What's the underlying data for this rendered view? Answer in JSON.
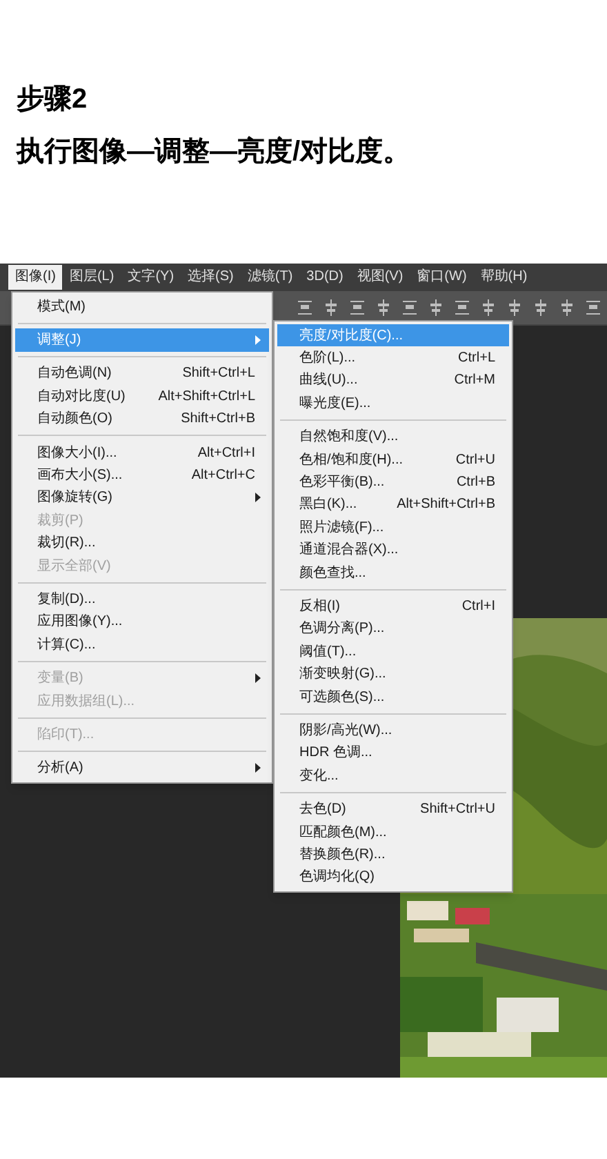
{
  "heading": "步骤2",
  "instruction": "执行图像—调整—亮度/对比度。",
  "menubar": [
    {
      "label": "图像(I)",
      "selected": true
    },
    {
      "label": "图层(L)",
      "selected": false
    },
    {
      "label": "文字(Y)",
      "selected": false
    },
    {
      "label": "选择(S)",
      "selected": false
    },
    {
      "label": "滤镜(T)",
      "selected": false
    },
    {
      "label": "3D(D)",
      "selected": false
    },
    {
      "label": "视图(V)",
      "selected": false
    },
    {
      "label": "窗口(W)",
      "selected": false
    },
    {
      "label": "帮助(H)",
      "selected": false
    }
  ],
  "menu": [
    [
      {
        "label": "模式(M)",
        "disabled": false,
        "submenu": false,
        "selected": false
      }
    ],
    [
      {
        "label": "调整(J)",
        "disabled": false,
        "submenu": true,
        "selected": true
      }
    ],
    [
      {
        "label": "自动色调(N)",
        "shortcut": "Shift+Ctrl+L",
        "disabled": false,
        "submenu": false,
        "selected": false
      },
      {
        "label": "自动对比度(U)",
        "shortcut": "Alt+Shift+Ctrl+L",
        "disabled": false,
        "submenu": false,
        "selected": false
      },
      {
        "label": "自动颜色(O)",
        "shortcut": "Shift+Ctrl+B",
        "disabled": false,
        "submenu": false,
        "selected": false
      }
    ],
    [
      {
        "label": "图像大小(I)...",
        "shortcut": "Alt+Ctrl+I",
        "disabled": false,
        "submenu": false,
        "selected": false
      },
      {
        "label": "画布大小(S)...",
        "shortcut": "Alt+Ctrl+C",
        "disabled": false,
        "submenu": false,
        "selected": false
      },
      {
        "label": "图像旋转(G)",
        "disabled": false,
        "submenu": true,
        "selected": false
      },
      {
        "label": "裁剪(P)",
        "disabled": true,
        "submenu": false,
        "selected": false
      },
      {
        "label": "裁切(R)...",
        "disabled": false,
        "submenu": false,
        "selected": false
      },
      {
        "label": "显示全部(V)",
        "disabled": true,
        "submenu": false,
        "selected": false
      }
    ],
    [
      {
        "label": "复制(D)...",
        "disabled": false,
        "submenu": false,
        "selected": false
      },
      {
        "label": "应用图像(Y)...",
        "disabled": false,
        "submenu": false,
        "selected": false
      },
      {
        "label": "计算(C)...",
        "disabled": false,
        "submenu": false,
        "selected": false
      }
    ],
    [
      {
        "label": "变量(B)",
        "disabled": true,
        "submenu": true,
        "selected": false
      },
      {
        "label": "应用数据组(L)...",
        "disabled": true,
        "submenu": false,
        "selected": false
      }
    ],
    [
      {
        "label": "陷印(T)...",
        "disabled": true,
        "submenu": false,
        "selected": false
      }
    ],
    [
      {
        "label": "分析(A)",
        "disabled": false,
        "submenu": true,
        "selected": false
      }
    ]
  ],
  "submenu": [
    [
      {
        "label": "亮度/对比度(C)...",
        "selected": true
      },
      {
        "label": "色阶(L)...",
        "shortcut": "Ctrl+L",
        "selected": false
      },
      {
        "label": "曲线(U)...",
        "shortcut": "Ctrl+M",
        "selected": false
      },
      {
        "label": "曝光度(E)...",
        "selected": false
      }
    ],
    [
      {
        "label": "自然饱和度(V)...",
        "selected": false
      },
      {
        "label": "色相/饱和度(H)...",
        "shortcut": "Ctrl+U",
        "selected": false
      },
      {
        "label": "色彩平衡(B)...",
        "shortcut": "Ctrl+B",
        "selected": false
      },
      {
        "label": "黑白(K)...",
        "shortcut": "Alt+Shift+Ctrl+B",
        "selected": false
      },
      {
        "label": "照片滤镜(F)...",
        "selected": false
      },
      {
        "label": "通道混合器(X)...",
        "selected": false
      },
      {
        "label": "颜色查找...",
        "selected": false
      }
    ],
    [
      {
        "label": "反相(I)",
        "shortcut": "Ctrl+I",
        "selected": false
      },
      {
        "label": "色调分离(P)...",
        "selected": false
      },
      {
        "label": "阈值(T)...",
        "selected": false
      },
      {
        "label": "渐变映射(G)...",
        "selected": false
      },
      {
        "label": "可选颜色(S)...",
        "selected": false
      }
    ],
    [
      {
        "label": "阴影/高光(W)...",
        "selected": false
      },
      {
        "label": "HDR 色调...",
        "selected": false
      },
      {
        "label": "变化...",
        "selected": false
      }
    ],
    [
      {
        "label": "去色(D)",
        "shortcut": "Shift+Ctrl+U",
        "selected": false
      },
      {
        "label": "匹配颜色(M)...",
        "selected": false
      },
      {
        "label": "替换颜色(R)...",
        "selected": false
      },
      {
        "label": "色调均化(Q)",
        "selected": false
      }
    ]
  ]
}
